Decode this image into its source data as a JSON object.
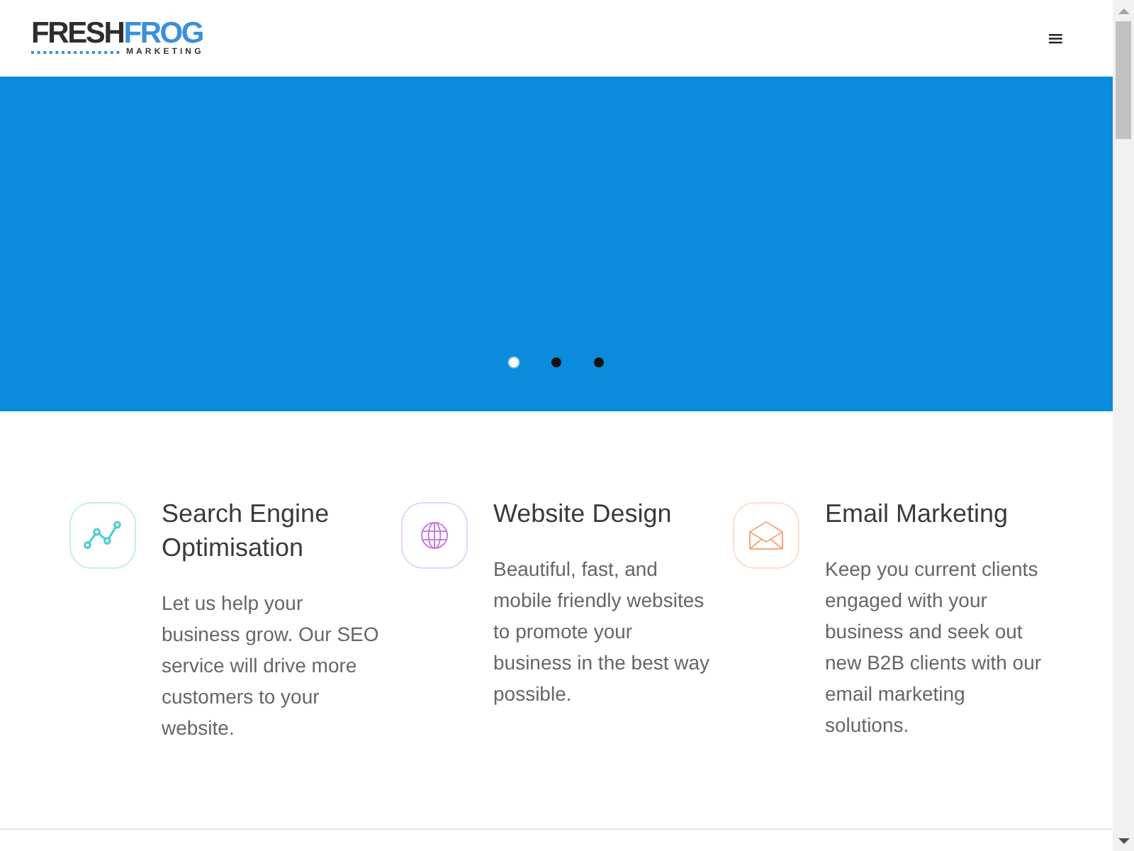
{
  "header": {
    "logo": {
      "first_word": "FRESH",
      "second_word": "FROG",
      "tagline": "MARKETING"
    },
    "menu_button": "≡"
  },
  "hero": {
    "dots": [
      {
        "selected": true
      },
      {
        "selected": false
      },
      {
        "selected": false
      }
    ]
  },
  "services": [
    {
      "kind": "seo",
      "color": "#4fcfd3",
      "title": "Search Engine Optimisation",
      "text": "Let us help your business grow. Our SEO service will drive more customers to your website."
    },
    {
      "kind": "web",
      "color": "#c57de6",
      "title": "Website Design",
      "text": "Beautiful, fast, and mobile friendly websites to promote your business in the best way possible."
    },
    {
      "kind": "email",
      "color": "#f3a77f",
      "title": "Email Marketing",
      "text": "Keep you current clients engaged with your business and seek out new B2B clients with our email marketing solutions."
    }
  ]
}
